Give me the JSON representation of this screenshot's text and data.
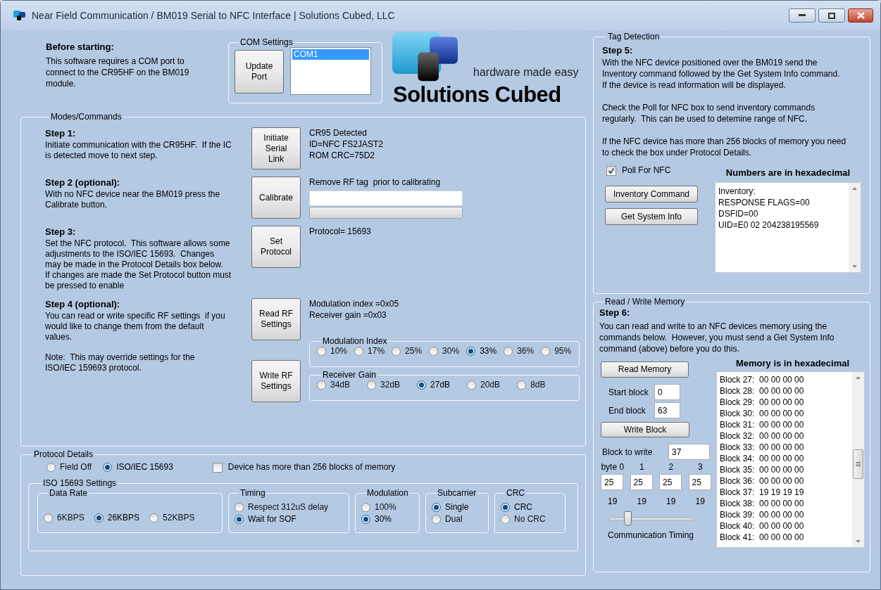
{
  "window": {
    "title": "Near Field Communication / BM019 Serial to NFC Interface | Solutions Cubed, LLC"
  },
  "intro": {
    "heading": "Before starting:",
    "text": "This software requires a COM port to connect to the CR95HF on the BM019 module."
  },
  "com_settings": {
    "title": "COM Settings",
    "button": "Update Port",
    "ports": [
      {
        "label": "COM1",
        "selected": true
      }
    ]
  },
  "logo": {
    "tagline": "hardware made easy",
    "name": "Solutions Cubed"
  },
  "modes": {
    "title": "Modes/Commands",
    "steps": [
      {
        "heading": "Step 1:",
        "text": "Initiate communication with the CR95HF.  If the IC is detected move to next step.",
        "buttons": [
          "Initiate Serial Link"
        ],
        "status": [
          "CR95 Detected",
          "ID=NFC FS2JAST2",
          "ROM CRC=75D2"
        ]
      },
      {
        "heading": "Step 2 (optional):",
        "text": "With no NFC device near the BM019 press the Calibrate button.",
        "buttons": [
          "Calibrate"
        ],
        "status": [
          "Remove RF tag  prior to calibrating"
        ],
        "progress": {
          "level": 0
        }
      },
      {
        "heading": "Step 3:",
        "text": "Set the NFC protocol.  This software allows some adjustments to the ISO/IEC 15693.  Changes may be made in the Protocol Details box below.  If changes are made the Set Protocol button must be pressed to enable",
        "buttons": [
          "Set Protocol"
        ],
        "status": [
          "Protocol= 15693"
        ]
      },
      {
        "heading": "Step 4 (optional):",
        "text": "You can read or write specific RF settings  if you would like to change them from the default values.",
        "note": "Note:  This may override settings for the ISO/IEC 159693 protocol.",
        "buttons": [
          "Read RF Settings",
          "Write RF Settings"
        ],
        "status": [
          "Modulation index =0x05",
          "Receiver gain =0x03"
        ],
        "groups": [
          {
            "title": "Modulation Index",
            "options": [
              {
                "label": "10%",
                "selected": false
              },
              {
                "label": "17%",
                "selected": false
              },
              {
                "label": "25%",
                "selected": false
              },
              {
                "label": "30%",
                "selected": false
              },
              {
                "label": "33%",
                "selected": true
              },
              {
                "label": "36%",
                "selected": false
              },
              {
                "label": "95%",
                "selected": false
              }
            ]
          },
          {
            "title": "Receiver Gain",
            "options": [
              {
                "label": "34dB",
                "selected": false
              },
              {
                "label": "32dB",
                "selected": false
              },
              {
                "label": "27dB",
                "selected": true
              },
              {
                "label": "20dB",
                "selected": false
              },
              {
                "label": "8dB",
                "selected": false
              }
            ]
          }
        ]
      }
    ]
  },
  "protocol": {
    "title": "Protocol Details",
    "modes": [
      {
        "label": "Field Off",
        "selected": false
      },
      {
        "label": "ISO/IEC 15693",
        "selected": true
      }
    ],
    "large_memory": {
      "label": "Device has more than 256 blocks of memory",
      "checked": false
    },
    "iso": {
      "title": "ISO 15693 Settings",
      "groups": [
        {
          "title": "Data Rate",
          "kind": "row",
          "options": [
            {
              "label": "6KBPS",
              "selected": false
            },
            {
              "label": "26KBPS",
              "selected": true
            },
            {
              "label": "52KBPS",
              "selected": false
            }
          ]
        },
        {
          "title": "Timing",
          "kind": "column",
          "options": [
            {
              "label": "Respect 312uS delay",
              "selected": false
            },
            {
              "label": "Wait for SOF",
              "selected": true
            }
          ]
        },
        {
          "title": "Modulation",
          "kind": "column",
          "options": [
            {
              "label": "100%",
              "selected": false
            },
            {
              "label": "30%",
              "selected": true
            }
          ]
        },
        {
          "title": "Subcarrier",
          "kind": "column",
          "options": [
            {
              "label": "Single",
              "selected": true
            },
            {
              "label": "Dual",
              "selected": false
            }
          ]
        },
        {
          "title": "CRC",
          "kind": "column",
          "options": [
            {
              "label": "CRC",
              "selected": true
            },
            {
              "label": "No CRC",
              "selected": false
            }
          ]
        }
      ]
    }
  },
  "tag_detection": {
    "title": "Tag Detection",
    "heading": "Step 5:",
    "paragraphs": [
      "With the NFC device positioned over the BM019 send the Inventory command followed by the Get System Info command.  If the device is read information will be displayed.",
      "Check the Poll for NFC box to send inventory commands regularly.  This can be used to detemine range of NFC.",
      "If the NFC device has more than 256 blocks of memory you need to check the box under Protocol Details."
    ],
    "poll": {
      "label": "Poll For NFC",
      "checked": true
    },
    "buttons": [
      "Inventory Command",
      "Get System Info"
    ],
    "output_label": "Numbers are in hexadecimal",
    "output_lines": [
      "Inventory:",
      "RESPONSE FLAGS=00",
      "DSFID=00",
      "UID=E0 02 204238195569"
    ]
  },
  "memory": {
    "title": "Read / Write Memory",
    "heading": "Step 6:",
    "text": "You can read and write to an NFC devices memory using the commands below.  However, you must send a Get System Info command (above) before you do this.",
    "read_button": "Read Memory",
    "start": {
      "label": "Start block",
      "value": "0"
    },
    "end": {
      "label": "End block",
      "value": "63"
    },
    "write_button": "Write Block",
    "block_to_write": {
      "label": "Block to write",
      "value": "37"
    },
    "bytes": [
      {
        "label": "byte 0",
        "value": "25",
        "reading": "19"
      },
      {
        "label": "1",
        "value": "25",
        "reading": "19"
      },
      {
        "label": "2",
        "value": "25",
        "reading": "19"
      },
      {
        "label": "3",
        "value": "25",
        "reading": "19"
      }
    ],
    "timing": {
      "label": "Communication Timing",
      "level": 0.22
    },
    "list_label": "Memory is in hexadecimal",
    "lines": [
      "Block 27:  00 00 00 00",
      "Block 28:  00 00 00 00",
      "Block 29:  00 00 00 00",
      "Block 30:  00 00 00 00",
      "Block 31:  00 00 00 00",
      "Block 32:  00 00 00 00",
      "Block 33:  00 00 00 00",
      "Block 34:  00 00 00 00",
      "Block 35:  00 00 00 00",
      "Block 36:  00 00 00 00",
      "Block 37:  19 19 19 19",
      "Block 38:  00 00 00 00",
      "Block 39:  00 00 00 00",
      "Block 40:  00 00 00 00",
      "Block 41:  00 00 00 00"
    ]
  }
}
